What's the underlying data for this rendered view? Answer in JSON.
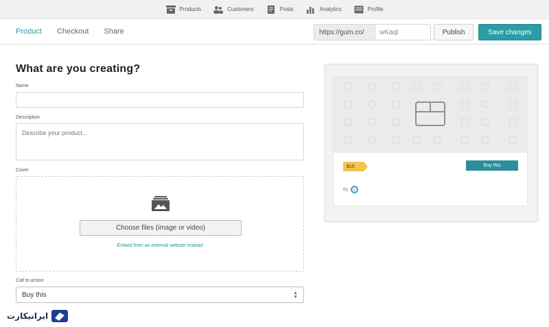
{
  "topnav": {
    "items": [
      {
        "label": "Products",
        "icon": "products-icon"
      },
      {
        "label": "Customers",
        "icon": "customers-icon"
      },
      {
        "label": "Posts",
        "icon": "posts-icon"
      },
      {
        "label": "Analytics",
        "icon": "analytics-icon"
      },
      {
        "label": "Profile",
        "icon": "profile-icon"
      }
    ]
  },
  "tabs": {
    "items": [
      {
        "label": "Product",
        "active": true
      },
      {
        "label": "Checkout",
        "active": false
      },
      {
        "label": "Share",
        "active": false
      }
    ]
  },
  "url": {
    "prefix": "https://gum.co/",
    "slug": "wKaql"
  },
  "actions": {
    "publish_label": "Publish",
    "save_label": "Save changes"
  },
  "form": {
    "title": "What are you creating?",
    "name_label": "Name",
    "name_value": "",
    "description_label": "Description",
    "description_placeholder": "Describe your product...",
    "cover_label": "Cover",
    "choose_files_label": "Choose files (image or video)",
    "embed_link_label": "Embed from an external website instead",
    "cta_label": "Call to action",
    "cta_selected": "Buy this"
  },
  "preview": {
    "price": "$15",
    "buy_label": "Buy this",
    "by_label": "By"
  },
  "watermark": {
    "text": "ایرانیکارت"
  },
  "colors": {
    "accent": "#2a9da6",
    "price_badge": "#f5c24b"
  }
}
